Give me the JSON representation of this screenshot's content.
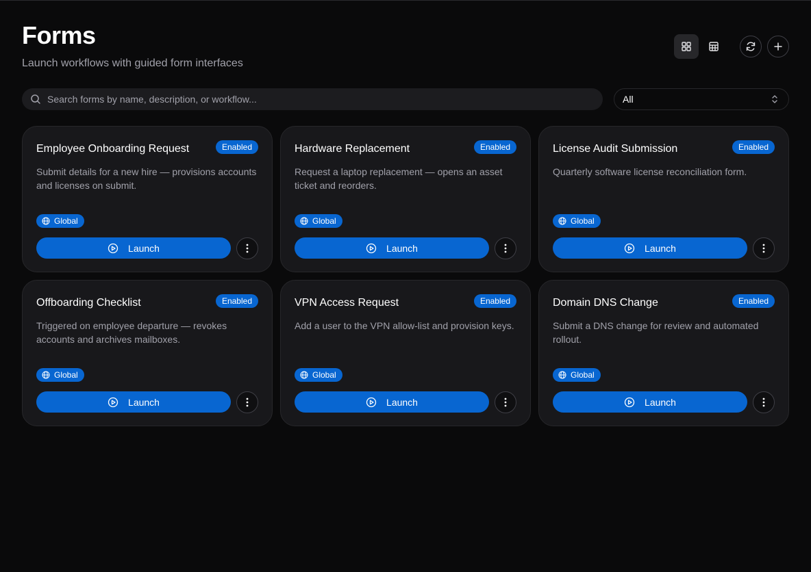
{
  "header": {
    "title": "Forms",
    "subtitle": "Launch workflows with guided form interfaces"
  },
  "toolbar": {
    "grid_view_icon": "grid-icon",
    "table_view_icon": "table-icon",
    "refresh_icon": "refresh-icon",
    "add_icon": "plus-icon",
    "active_view": "grid"
  },
  "search": {
    "placeholder": "Search forms by name, description, or workflow...",
    "value": ""
  },
  "filter": {
    "selected": "All"
  },
  "colors": {
    "accent": "#0866d1",
    "background": "#0a0a0b",
    "card": "#18181b"
  },
  "forms": [
    {
      "title": "Employee Onboarding Request",
      "status": "Enabled",
      "description": "Submit details for a new hire — provisions accounts and licenses on submit.",
      "scope": "Global",
      "launch_label": "Launch"
    },
    {
      "title": "Hardware Replacement",
      "status": "Enabled",
      "description": "Request a laptop replacement — opens an asset ticket and reorders.",
      "scope": "Global",
      "launch_label": "Launch"
    },
    {
      "title": "License Audit Submission",
      "status": "Enabled",
      "description": "Quarterly software license reconciliation form.",
      "scope": "Global",
      "launch_label": "Launch"
    },
    {
      "title": "Offboarding Checklist",
      "status": "Enabled",
      "description": "Triggered on employee departure — revokes accounts and archives mailboxes.",
      "scope": "Global",
      "launch_label": "Launch"
    },
    {
      "title": "VPN Access Request",
      "status": "Enabled",
      "description": "Add a user to the VPN allow-list and provision keys.",
      "scope": "Global",
      "launch_label": "Launch"
    },
    {
      "title": "Domain DNS Change",
      "status": "Enabled",
      "description": "Submit a DNS change for review and automated rollout.",
      "scope": "Global",
      "launch_label": "Launch"
    }
  ]
}
